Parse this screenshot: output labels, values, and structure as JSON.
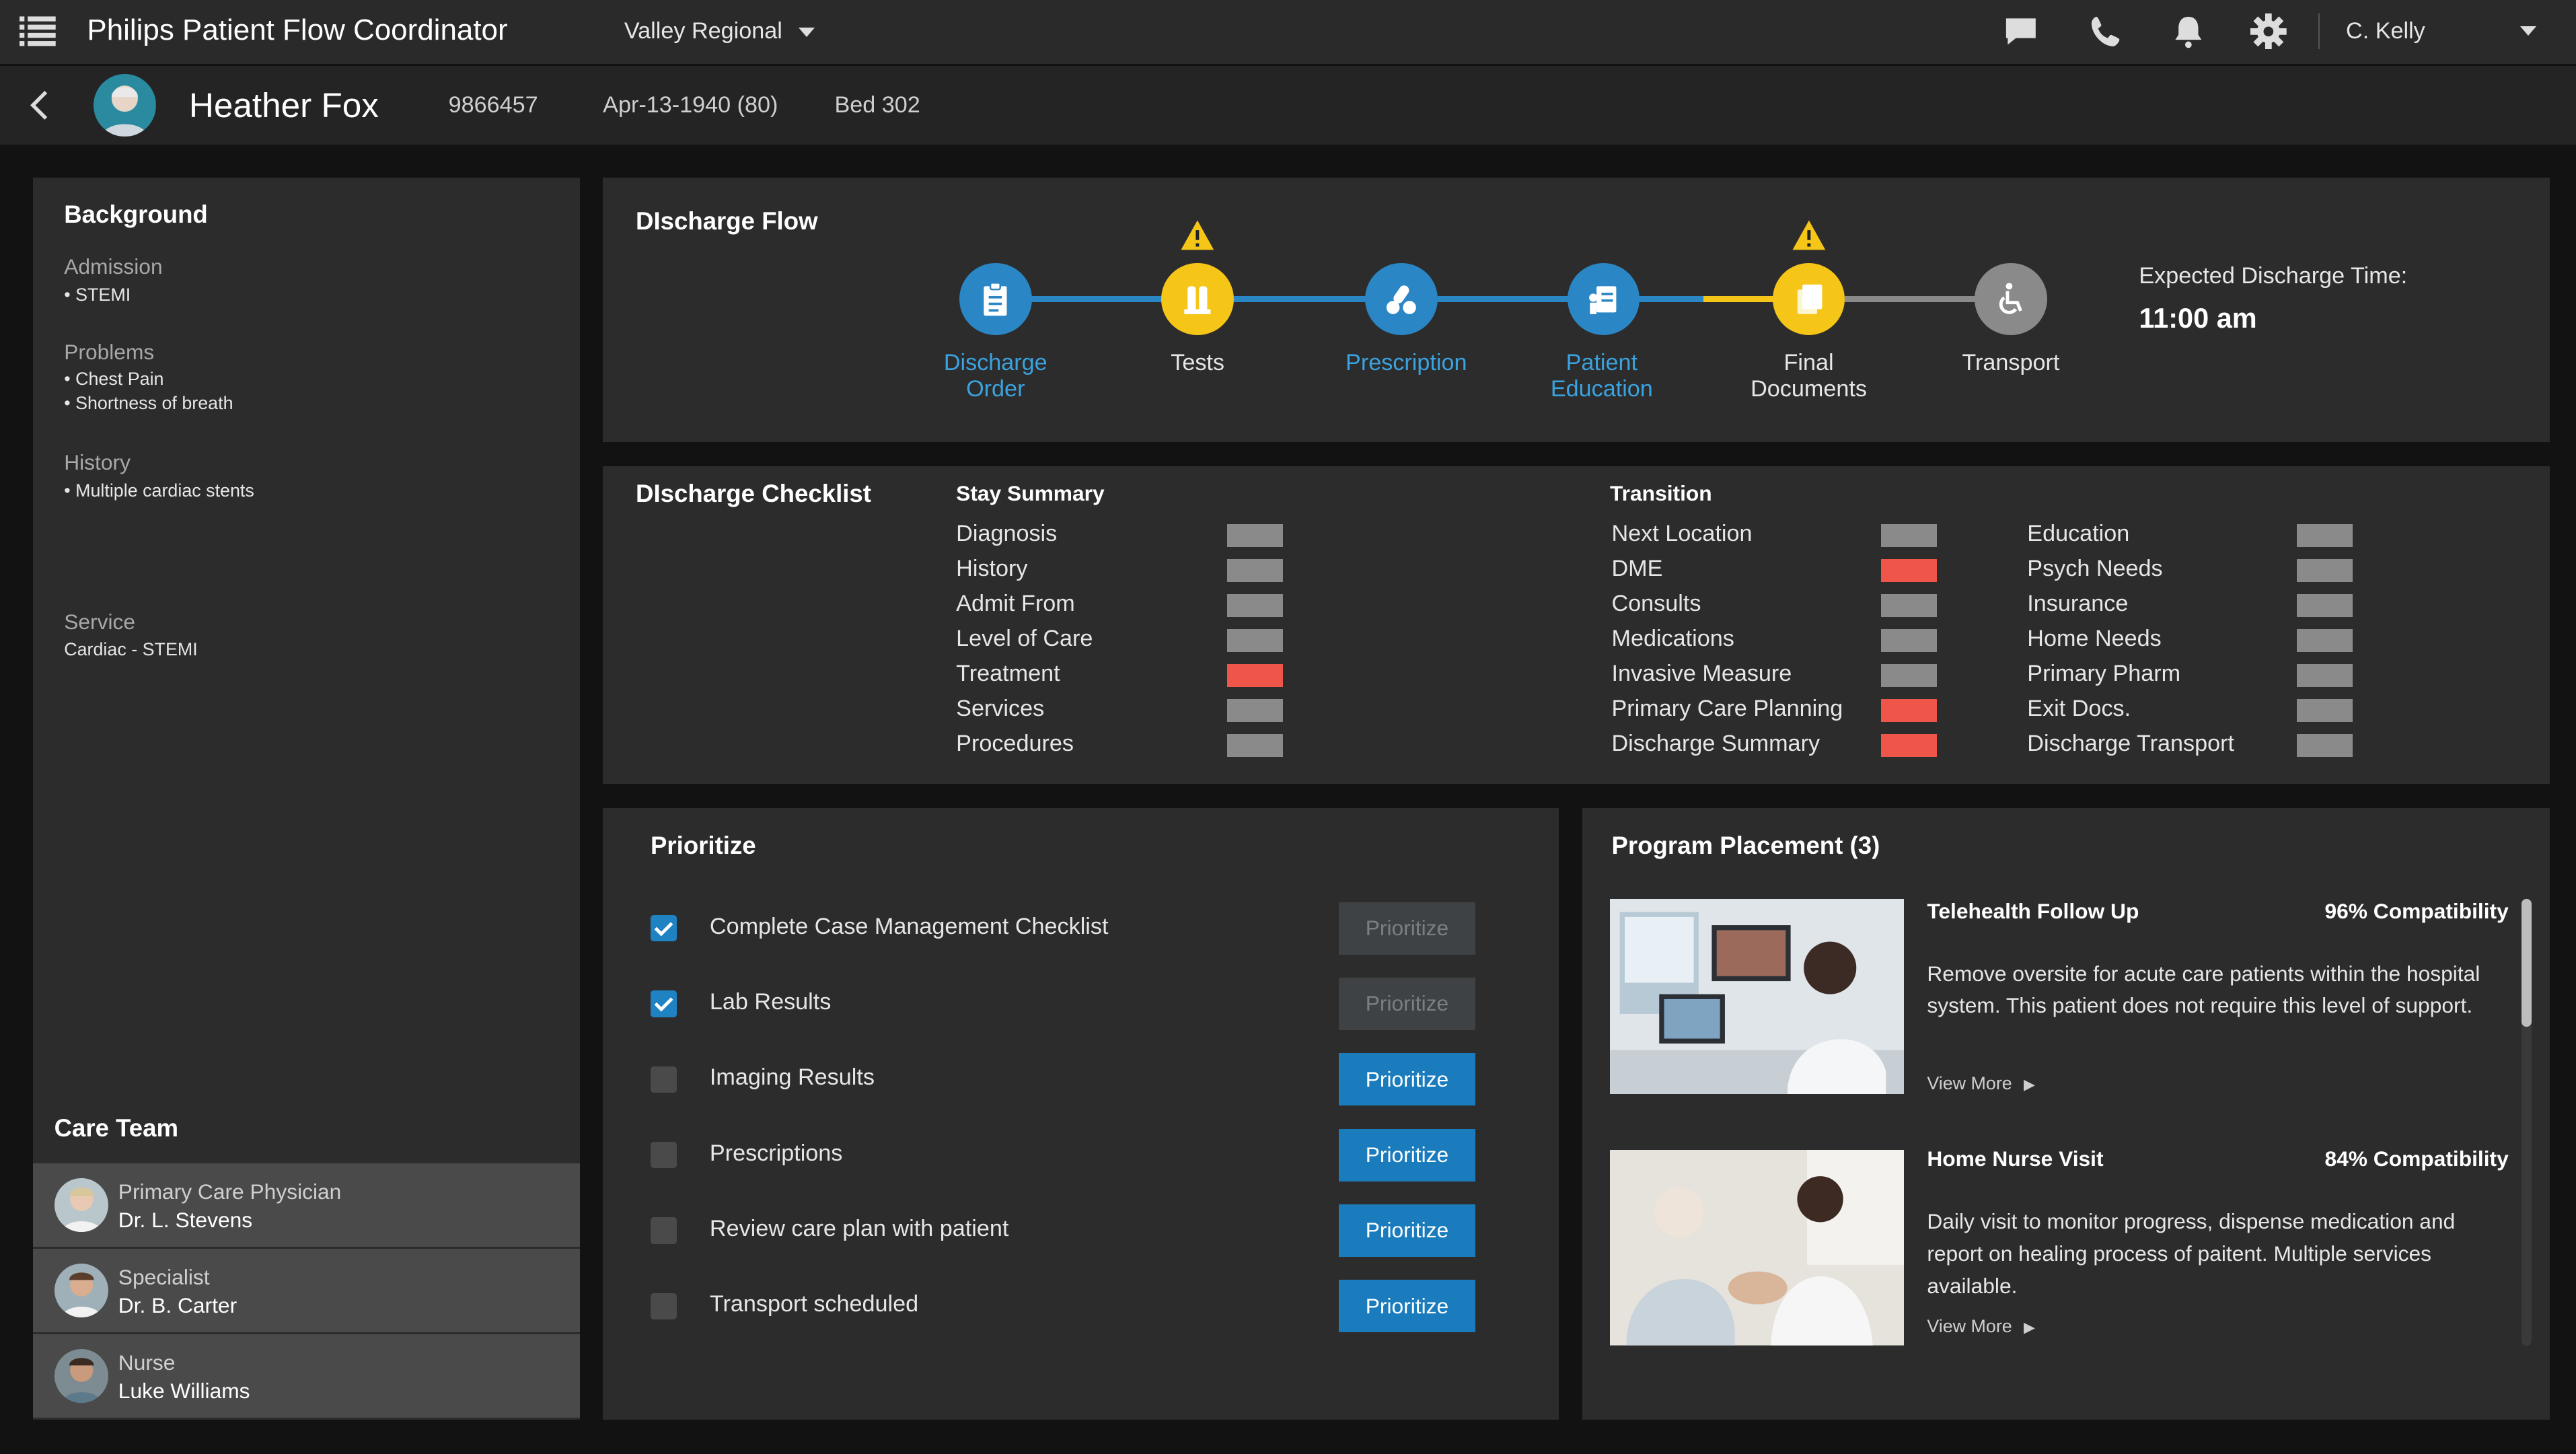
{
  "app": {
    "title": "Philips Patient Flow Coordinator",
    "facility": "Valley Regional",
    "user": "C. Kelly"
  },
  "patient": {
    "name": "Heather Fox",
    "mrn": "9866457",
    "dob": "Apr-13-1940 (80)",
    "bed": "Bed 302"
  },
  "background": {
    "title": "Background",
    "admission_label": "Admission",
    "admission": "• STEMI",
    "problems_label": "Problems",
    "problems": [
      "• Chest Pain",
      "• Shortness of breath"
    ],
    "history_label": "History",
    "history": "• Multiple cardiac stents",
    "service_label": "Service",
    "service": "Cardiac - STEMI"
  },
  "care_team": {
    "title": "Care Team",
    "members": [
      {
        "role": "Primary Care Physician",
        "name": "Dr. L. Stevens"
      },
      {
        "role": "Specialist",
        "name": "Dr. B. Carter"
      },
      {
        "role": "Nurse",
        "name": "Luke Williams"
      }
    ]
  },
  "discharge_flow": {
    "title": "DIscharge Flow",
    "steps": [
      {
        "line1": "Discharge",
        "line2": "Order",
        "icon": "clipboard-icon",
        "status": "complete"
      },
      {
        "line1": "Tests",
        "line2": "",
        "icon": "flask-icon",
        "status": "warning"
      },
      {
        "line1": "Prescription",
        "line2": "",
        "icon": "pills-icon",
        "status": "complete"
      },
      {
        "line1": "Patient",
        "line2": "Education",
        "icon": "document-person-icon",
        "status": "complete"
      },
      {
        "line1": "Final",
        "line2": "Documents",
        "icon": "documents-icon",
        "status": "warning"
      },
      {
        "line1": "Transport",
        "line2": "",
        "icon": "wheelchair-icon",
        "status": "pending"
      }
    ],
    "expected_label": "Expected Discharge Time:",
    "expected_time": "11:00 am"
  },
  "checklist": {
    "title": "DIscharge Checklist",
    "stay_title": "Stay Summary",
    "transition_title": "Transition",
    "stay": [
      {
        "label": "Diagnosis",
        "status": "gray"
      },
      {
        "label": "History",
        "status": "gray"
      },
      {
        "label": "Admit From",
        "status": "gray"
      },
      {
        "label": "Level of Care",
        "status": "gray"
      },
      {
        "label": "Treatment",
        "status": "red"
      },
      {
        "label": "Services",
        "status": "gray"
      },
      {
        "label": "Procedures",
        "status": "gray"
      }
    ],
    "transition_a": [
      {
        "label": "Next Location",
        "status": "gray"
      },
      {
        "label": "DME",
        "status": "red"
      },
      {
        "label": "Consults",
        "status": "gray"
      },
      {
        "label": "Medications",
        "status": "gray"
      },
      {
        "label": "Invasive Measure",
        "status": "gray"
      },
      {
        "label": "Primary Care Planning",
        "status": "red"
      },
      {
        "label": "Discharge Summary",
        "status": "red"
      }
    ],
    "transition_b": [
      {
        "label": "Education",
        "status": "gray"
      },
      {
        "label": "Psych Needs",
        "status": "gray"
      },
      {
        "label": "Insurance",
        "status": "gray"
      },
      {
        "label": "Home Needs",
        "status": "gray"
      },
      {
        "label": "Primary Pharm",
        "status": "gray"
      },
      {
        "label": "Exit Docs.",
        "status": "gray"
      },
      {
        "label": "Discharge Transport",
        "status": "gray"
      }
    ],
    "colors": {
      "gray": "#8a8a8a",
      "red": "#f0554a"
    }
  },
  "prioritize": {
    "title": "Prioritize",
    "button_label": "Prioritize",
    "items": [
      {
        "label": "Complete Case Management Checklist",
        "checked": true
      },
      {
        "label": "Lab Results",
        "checked": true
      },
      {
        "label": "Imaging Results",
        "checked": false
      },
      {
        "label": "Prescriptions",
        "checked": false
      },
      {
        "label": "Review care plan with patient",
        "checked": false
      },
      {
        "label": "Transport scheduled",
        "checked": false
      }
    ]
  },
  "programs": {
    "title": "Program Placement (3)",
    "view_more": "View More",
    "items": [
      {
        "name": "Telehealth Follow Up",
        "compat": "96% Compatibility",
        "desc": "Remove oversite for acute care patients within the hospital system.  This patient does not require this level of support."
      },
      {
        "name": "Home Nurse Visit",
        "compat": "84% Compatibility",
        "desc": "Daily visit to monitor progress, dispense medication and report on healing process of paitent.  Multiple services available."
      }
    ]
  },
  "theme": {
    "accent_blue": "#2a86c4",
    "warning_yellow": "#f5c518",
    "pending_gray": "#8a8a8a"
  }
}
